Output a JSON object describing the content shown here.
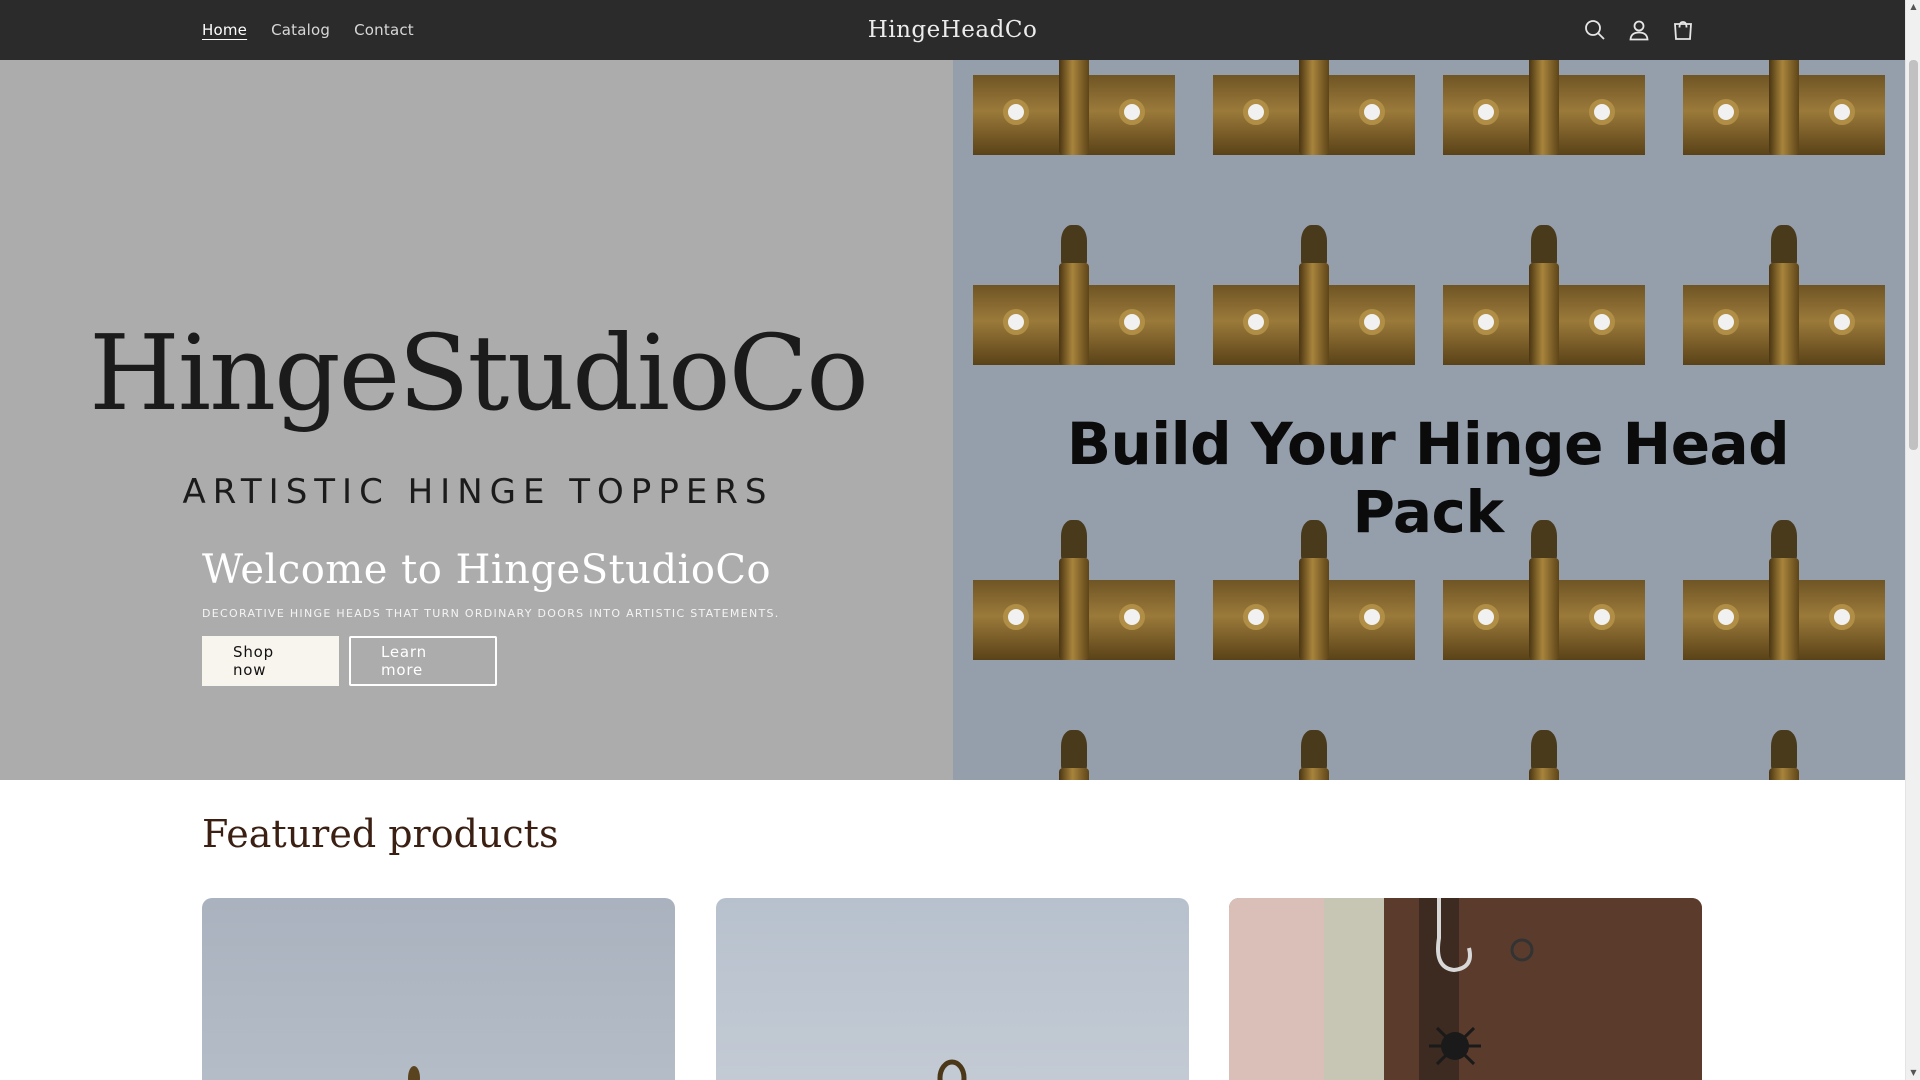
{
  "header": {
    "brand": "HingeHeadCo",
    "nav": [
      {
        "label": "Home",
        "active": true
      },
      {
        "label": "Catalog",
        "active": false
      },
      {
        "label": "Contact",
        "active": false
      }
    ],
    "icons": [
      "search-icon",
      "account-icon",
      "cart-icon"
    ]
  },
  "hero": {
    "logo_name": "HingeStudioCo",
    "logo_tagline": "ARTISTIC HINGE TOPPERS",
    "pack_banner": "Build Your Hinge Head Pack",
    "title": "Welcome to HingeStudioCo",
    "description": "DECORATIVE HINGE HEADS THAT TURN ORDINARY DOORS INTO ARTISTIC STATEMENTS.",
    "primary_button": "Shop now",
    "secondary_button": "Learn more"
  },
  "featured": {
    "title": "Featured products"
  },
  "colors": {
    "header_bg": "#2b2b2b",
    "hero_left_bg": "#acacac",
    "hero_right_bg": "#959fac",
    "featured_title": "#3a1f12"
  }
}
